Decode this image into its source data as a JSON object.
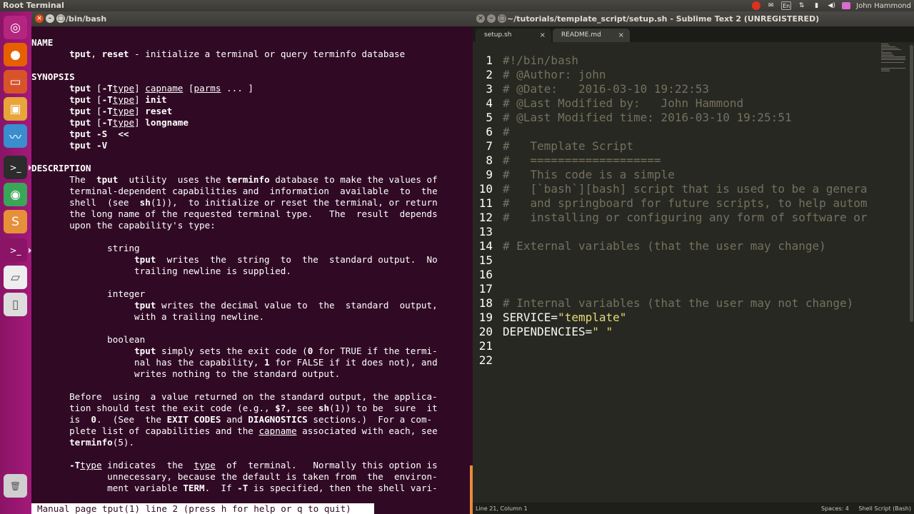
{
  "top_panel": {
    "title": "Root Terminal",
    "lang": "En",
    "user": "John Hammond"
  },
  "launcher": {
    "items": [
      {
        "name": "ubuntu-dash",
        "color": "#b3257f",
        "glyph": "◎"
      },
      {
        "name": "firefox",
        "color": "#e66000",
        "glyph": "●"
      },
      {
        "name": "files",
        "color": "#d9532a",
        "glyph": "▭"
      },
      {
        "name": "software-center",
        "color": "#e7a53a",
        "glyph": "▣"
      },
      {
        "name": "system-monitor",
        "color": "#3a8ecd",
        "glyph": "〰"
      },
      {
        "name": "terminal",
        "color": "#2c2c2c",
        "glyph": ">_"
      },
      {
        "name": "chrome",
        "color": "#3aa658",
        "glyph": "◉"
      },
      {
        "name": "sublime-text",
        "color": "#e7903a",
        "glyph": "S"
      },
      {
        "name": "terminal-2",
        "color": "#8a1466",
        "glyph": ">_"
      },
      {
        "name": "removable-drive",
        "color": "#eeeeee",
        "glyph": "▱"
      },
      {
        "name": "trash-2",
        "color": "#dddddd",
        "glyph": "▯"
      },
      {
        "name": "trash",
        "color": "#cfcfcf",
        "glyph": "🗑"
      }
    ]
  },
  "terminal": {
    "title": "/bin/bash",
    "status": "Manual page tput(1) line 2 (press h for help or q to quit)"
  },
  "sublime": {
    "title": "~/tutorials/template_script/setup.sh - Sublime Text 2 (UNREGISTERED)",
    "tabs": [
      {
        "label": "setup.sh",
        "close": "×"
      },
      {
        "label": "README.md",
        "close": "×"
      }
    ],
    "lines": [
      {
        "n": "1",
        "t": "#!/bin/bash"
      },
      {
        "n": "2",
        "t": "# @Author: john"
      },
      {
        "n": "3",
        "t": "# @Date:   2016-03-10 19:22:53"
      },
      {
        "n": "4",
        "t": "# @Last Modified by:   John Hammond"
      },
      {
        "n": "5",
        "t": "# @Last Modified time: 2016-03-10 19:25:51"
      },
      {
        "n": "6",
        "t": "#"
      },
      {
        "n": "7",
        "t": "#   Template Script"
      },
      {
        "n": "8",
        "t": "#   ==================="
      },
      {
        "n": "9",
        "t": "#   This code is a simple"
      },
      {
        "n": "10",
        "t": "#   [`bash`][bash] script that is used to be a genera"
      },
      {
        "n": "11",
        "t": "#   and springboard for future scripts, to help autom"
      },
      {
        "n": "12",
        "t": "#   installing or configuring any form of software or"
      },
      {
        "n": "13",
        "t": ""
      },
      {
        "n": "14",
        "t": "# External variables (that the user may change)"
      },
      {
        "n": "15",
        "t": ""
      },
      {
        "n": "16",
        "t": ""
      },
      {
        "n": "17",
        "t": ""
      },
      {
        "n": "18",
        "t": "# Internal variables (that the user may not change)"
      },
      {
        "n": "19",
        "var": "SERVICE=",
        "str": "\"template\""
      },
      {
        "n": "20",
        "var": "DEPENDENCIES=",
        "str": "\" \""
      },
      {
        "n": "21",
        "t": ""
      },
      {
        "n": "22",
        "t": ""
      }
    ],
    "status": {
      "position": "Line 21, Column 1",
      "indent": "Spaces: 4",
      "syntax": "Shell Script (Bash)"
    }
  },
  "man_page": [
    [
      {
        "t": "NAME",
        "b": 1
      }
    ],
    [
      {
        "t": "       "
      },
      {
        "t": "tput",
        "b": 1
      },
      {
        "t": ", "
      },
      {
        "t": "reset",
        "b": 1
      },
      {
        "t": " - initialize a terminal or query terminfo database"
      }
    ],
    [],
    [
      {
        "t": "SYNOPSIS",
        "b": 1
      }
    ],
    [
      {
        "t": "       "
      },
      {
        "t": "tput",
        "b": 1
      },
      {
        "t": " ["
      },
      {
        "t": "-T",
        "b": 1
      },
      {
        "t": "type",
        "u": 1
      },
      {
        "t": "] "
      },
      {
        "t": "capname",
        "u": 1
      },
      {
        "t": " ["
      },
      {
        "t": "parms",
        "u": 1
      },
      {
        "t": " ... ]"
      }
    ],
    [
      {
        "t": "       "
      },
      {
        "t": "tput",
        "b": 1
      },
      {
        "t": " ["
      },
      {
        "t": "-T",
        "b": 1
      },
      {
        "t": "type",
        "u": 1
      },
      {
        "t": "] "
      },
      {
        "t": "init",
        "b": 1
      }
    ],
    [
      {
        "t": "       "
      },
      {
        "t": "tput",
        "b": 1
      },
      {
        "t": " ["
      },
      {
        "t": "-T",
        "b": 1
      },
      {
        "t": "type",
        "u": 1
      },
      {
        "t": "] "
      },
      {
        "t": "reset",
        "b": 1
      }
    ],
    [
      {
        "t": "       "
      },
      {
        "t": "tput",
        "b": 1
      },
      {
        "t": " ["
      },
      {
        "t": "-T",
        "b": 1
      },
      {
        "t": "type",
        "u": 1
      },
      {
        "t": "] "
      },
      {
        "t": "longname",
        "b": 1
      }
    ],
    [
      {
        "t": "       "
      },
      {
        "t": "tput -S",
        "b": 1
      },
      {
        "t": "  "
      },
      {
        "t": "<<",
        "b": 1
      }
    ],
    [
      {
        "t": "       "
      },
      {
        "t": "tput -V",
        "b": 1
      }
    ],
    [],
    [
      {
        "t": "DESCRIPTION",
        "b": 1
      }
    ],
    [
      {
        "t": "       The  "
      },
      {
        "t": "tput",
        "b": 1
      },
      {
        "t": "  utility  uses the "
      },
      {
        "t": "terminfo",
        "b": 1
      },
      {
        "t": " database to make the values of"
      }
    ],
    [
      {
        "t": "       terminal-dependent capabilities and  information  available  to  the"
      }
    ],
    [
      {
        "t": "       shell  (see  "
      },
      {
        "t": "sh",
        "b": 1
      },
      {
        "t": "(1)),  to initialize or reset the terminal, or return"
      }
    ],
    [
      {
        "t": "       the long name of the requested terminal type.   The  result  depends"
      }
    ],
    [
      {
        "t": "       upon the capability's type:"
      }
    ],
    [],
    [
      {
        "t": "              string"
      }
    ],
    [
      {
        "t": "                   "
      },
      {
        "t": "tput",
        "b": 1
      },
      {
        "t": "  writes  the  string  to  the  standard output.  No"
      }
    ],
    [
      {
        "t": "                   trailing newline is supplied."
      }
    ],
    [],
    [
      {
        "t": "              integer"
      }
    ],
    [
      {
        "t": "                   "
      },
      {
        "t": "tput",
        "b": 1
      },
      {
        "t": " writes the decimal value to  the  standard  output,"
      }
    ],
    [
      {
        "t": "                   with a trailing newline."
      }
    ],
    [],
    [
      {
        "t": "              boolean"
      }
    ],
    [
      {
        "t": "                   "
      },
      {
        "t": "tput",
        "b": 1
      },
      {
        "t": " simply sets the exit code ("
      },
      {
        "t": "0",
        "b": 1
      },
      {
        "t": " for TRUE if the termi-"
      }
    ],
    [
      {
        "t": "                   nal has the capability, "
      },
      {
        "t": "1",
        "b": 1
      },
      {
        "t": " for FALSE if it does not), and"
      }
    ],
    [
      {
        "t": "                   writes nothing to the standard output."
      }
    ],
    [],
    [
      {
        "t": "       Before  using  a value returned on the standard output, the applica-"
      }
    ],
    [
      {
        "t": "       tion should test the exit code (e.g., "
      },
      {
        "t": "$?",
        "b": 1
      },
      {
        "t": ", see "
      },
      {
        "t": "sh",
        "b": 1
      },
      {
        "t": "(1)) to be  sure  it"
      }
    ],
    [
      {
        "t": "       is  "
      },
      {
        "t": "0",
        "b": 1
      },
      {
        "t": ".  (See  the "
      },
      {
        "t": "EXIT CODES",
        "b": 1
      },
      {
        "t": " and "
      },
      {
        "t": "DIAGNOSTICS",
        "b": 1
      },
      {
        "t": " sections.)  For a com-"
      }
    ],
    [
      {
        "t": "       plete list of capabilities and the "
      },
      {
        "t": "capname",
        "u": 1
      },
      {
        "t": " associated with each, see"
      }
    ],
    [
      {
        "t": "       "
      },
      {
        "t": "terminfo",
        "b": 1
      },
      {
        "t": "(5)."
      }
    ],
    [],
    [
      {
        "t": "       "
      },
      {
        "t": "-T",
        "b": 1
      },
      {
        "t": "type",
        "u": 1
      },
      {
        "t": " indicates  the  "
      },
      {
        "t": "type",
        "u": 1
      },
      {
        "t": "  of  terminal.   Normally this option is"
      }
    ],
    [
      {
        "t": "              unnecessary, because the default is taken from  the  environ-"
      }
    ],
    [
      {
        "t": "              ment variable "
      },
      {
        "t": "TERM",
        "b": 1
      },
      {
        "t": ".  If "
      },
      {
        "t": "-T",
        "b": 1
      },
      {
        "t": " is specified, then the shell vari-"
      }
    ]
  ]
}
